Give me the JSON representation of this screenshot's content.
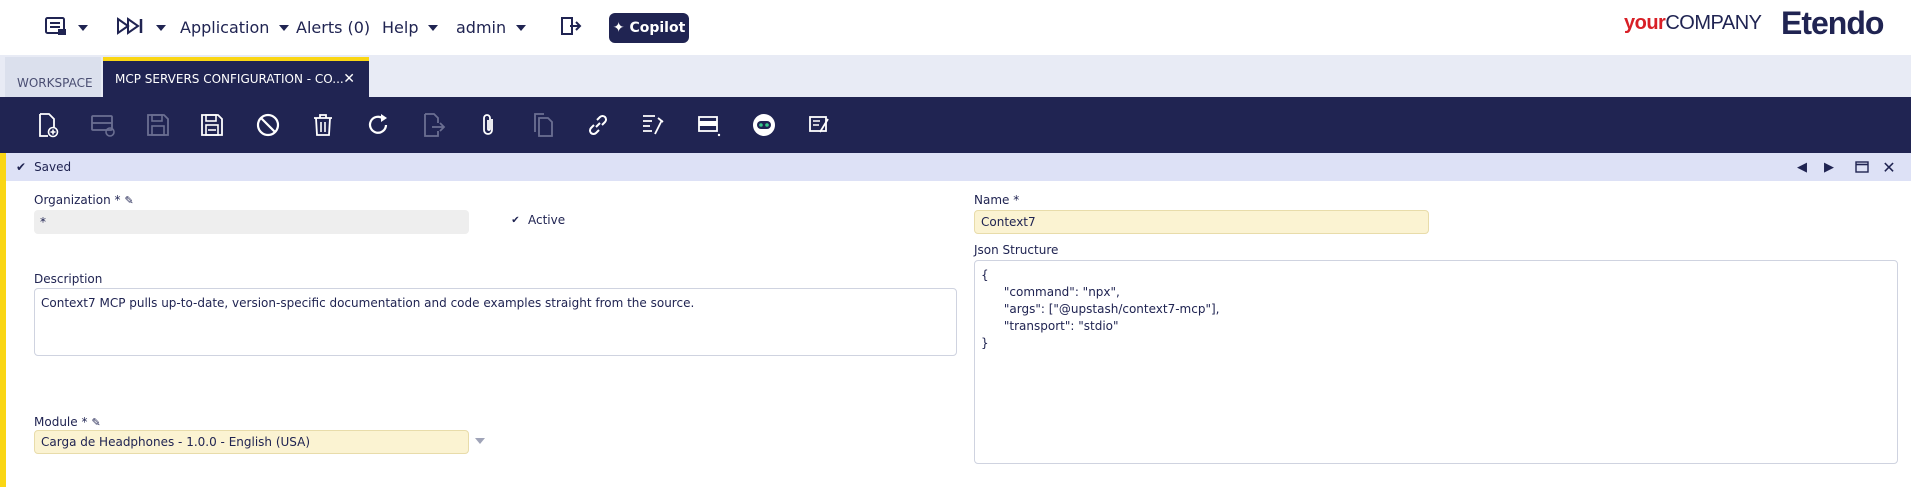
{
  "nav": {
    "application": "Application",
    "alerts": "Alerts (0)",
    "help": "Help",
    "user": "admin",
    "copilot": "Copilot"
  },
  "brand": {
    "your": "your",
    "company": "COMPANY",
    "etendo": "Etendo"
  },
  "tabs": {
    "workspace": "WORKSPACE",
    "active": "MCP SERVERS CONFIGURATION - CO..."
  },
  "status": {
    "text": "Saved"
  },
  "form": {
    "organization_label": "Organization *",
    "organization_value": "*",
    "active_label": "Active",
    "description_label": "Description",
    "description_value": "Context7 MCP pulls up-to-date, version-specific documentation and code examples straight from the source.",
    "module_label": "Module *",
    "module_value": "Carga de Headphones - 1.0.0 - English (USA)",
    "name_label": "Name *",
    "name_value": "Context7",
    "json_label": "Json Structure",
    "json_value": "{\n      \"command\": \"npx\",\n      \"args\": [\"@upstash/context7-mcp\"],\n      \"transport\": \"stdio\"\n}"
  },
  "colors": {
    "navy": "#202452",
    "accent_yellow": "#fad614",
    "status_bg": "#dde1f6",
    "required_field_bg": "#fbf3d2"
  }
}
